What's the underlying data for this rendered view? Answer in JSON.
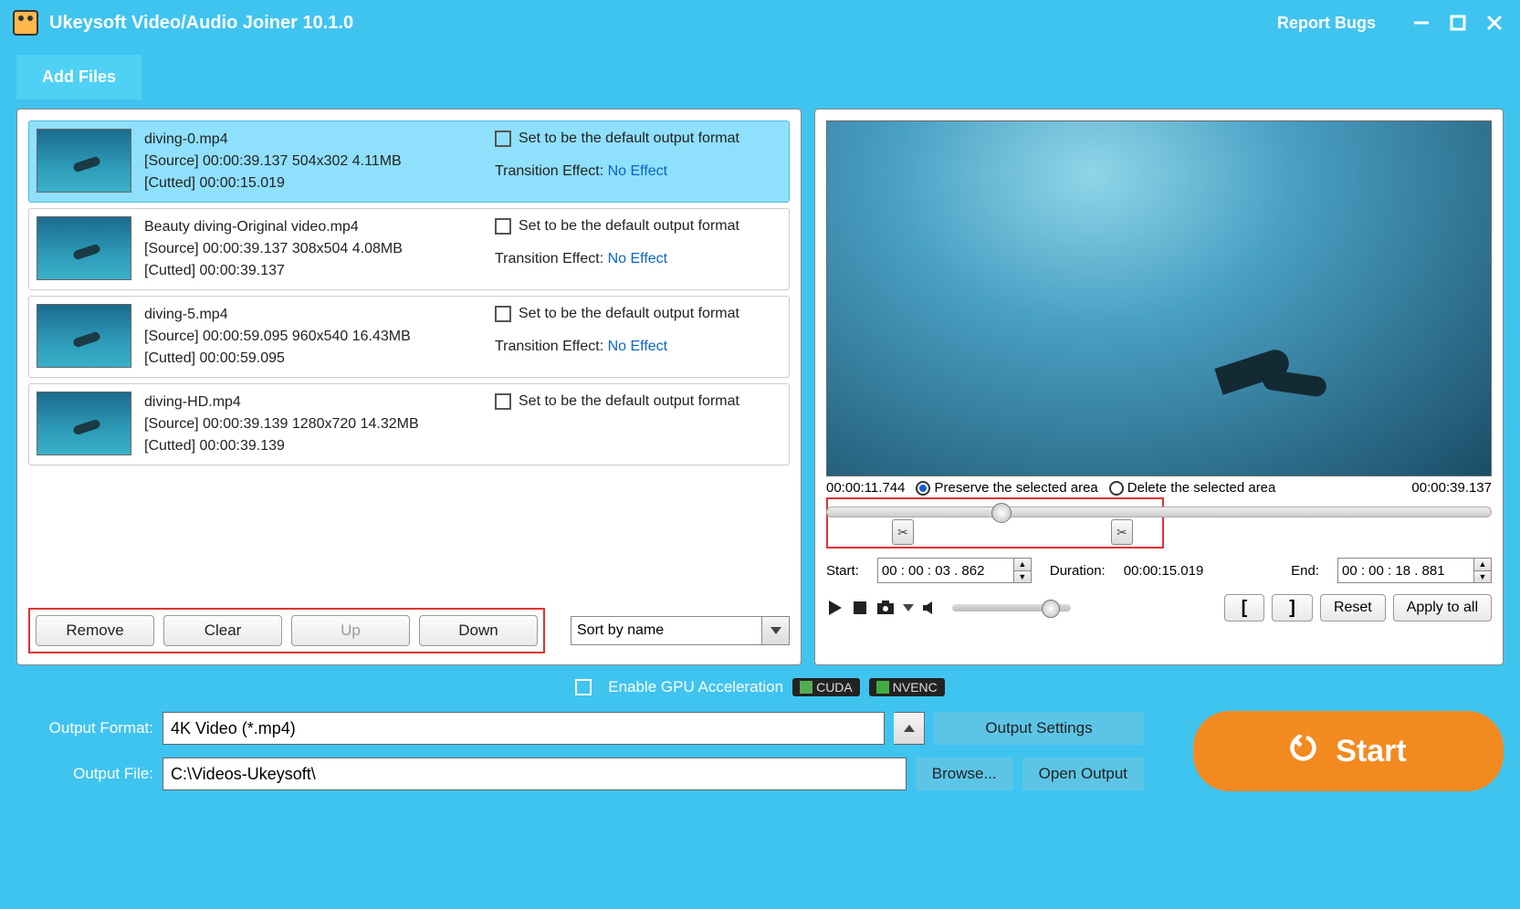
{
  "titlebar": {
    "title": "Ukeysoft Video/Audio Joiner 10.1.0",
    "report": "Report Bugs"
  },
  "add_files": "Add Files",
  "files": [
    {
      "name": "diving-0.mp4",
      "source": "[Source]  00:00:39.137  504x302  4.11MB",
      "cutted": "[Cutted]  00:00:15.019",
      "default_label": "Set to be the default output format",
      "trans_label": "Transition Effect:",
      "trans_value": "No Effect",
      "selected": true
    },
    {
      "name": "Beauty diving-Original video.mp4",
      "source": "[Source]  00:00:39.137  308x504  4.08MB",
      "cutted": "[Cutted]  00:00:39.137",
      "default_label": "Set to be the default output format",
      "trans_label": "Transition Effect:",
      "trans_value": "No Effect",
      "selected": false
    },
    {
      "name": "diving-5.mp4",
      "source": "[Source]  00:00:59.095  960x540  16.43MB",
      "cutted": "[Cutted]  00:00:59.095",
      "default_label": "Set to be the default output format",
      "trans_label": "Transition Effect:",
      "trans_value": "No Effect",
      "selected": false
    },
    {
      "name": "diving-HD.mp4",
      "source": "[Source]  00:00:39.139  1280x720  14.32MB",
      "cutted": "[Cutted]  00:00:39.139",
      "default_label": "Set to be the default output format",
      "trans_label": "",
      "trans_value": "",
      "selected": false
    }
  ],
  "buttons": {
    "remove": "Remove",
    "clear": "Clear",
    "up": "Up",
    "down": "Down"
  },
  "sort": "Sort by name",
  "trim": {
    "current": "00:00:11.744",
    "preserve": "Preserve the selected area",
    "delete": "Delete the selected area",
    "total": "00:00:39.137",
    "start_label": "Start:",
    "start": "00 : 00 : 03 . 862",
    "duration_label": "Duration:",
    "duration": "00:00:15.019",
    "end_label": "End:",
    "end": "00 : 00 : 18 . 881"
  },
  "controls": {
    "reset": "Reset",
    "apply": "Apply to all"
  },
  "gpu": {
    "enable": "Enable GPU Acceleration",
    "cuda": "CUDA",
    "nvenc": "NVENC"
  },
  "output": {
    "format_label": "Output Format:",
    "format": "4K Video (*.mp4)",
    "settings": "Output Settings",
    "file_label": "Output File:",
    "file": "C:\\Videos-Ukeysoft\\",
    "browse": "Browse...",
    "open": "Open Output",
    "start": "Start"
  }
}
